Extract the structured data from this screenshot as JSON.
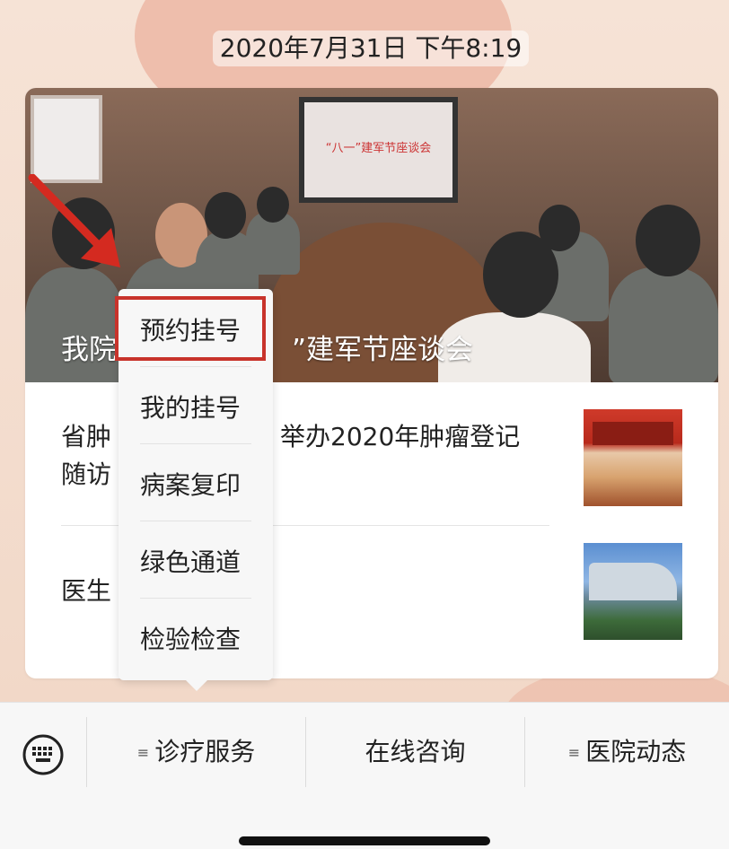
{
  "status": {
    "timestamp": "2020年7月31日 下午8:19"
  },
  "article_card": {
    "hero_title_left": "我院",
    "hero_title_right": "”建军节座谈会",
    "screen_caption": "“八一”建军节座谈会",
    "news": [
      {
        "title_line1_left": "省肿",
        "title_line1_right": "举办2020年肿瘤登记",
        "title_line2": "随访"
      },
      {
        "title": "医生"
      }
    ]
  },
  "popup_menu": {
    "items": [
      "预约挂号",
      "我的挂号",
      "病案复印",
      "绿色通道",
      "检验检查"
    ],
    "highlighted_index": 0
  },
  "bottom_menu": {
    "keyboard_icon": "keyboard-icon",
    "tabs": [
      {
        "label": "诊疗服务",
        "has_submenu": true
      },
      {
        "label": "在线咨询",
        "has_submenu": false
      },
      {
        "label": "医院动态",
        "has_submenu": true
      }
    ],
    "submenu_icon": "≡"
  },
  "colors": {
    "highlight": "#c8332b",
    "arrow": "#d42a20"
  }
}
